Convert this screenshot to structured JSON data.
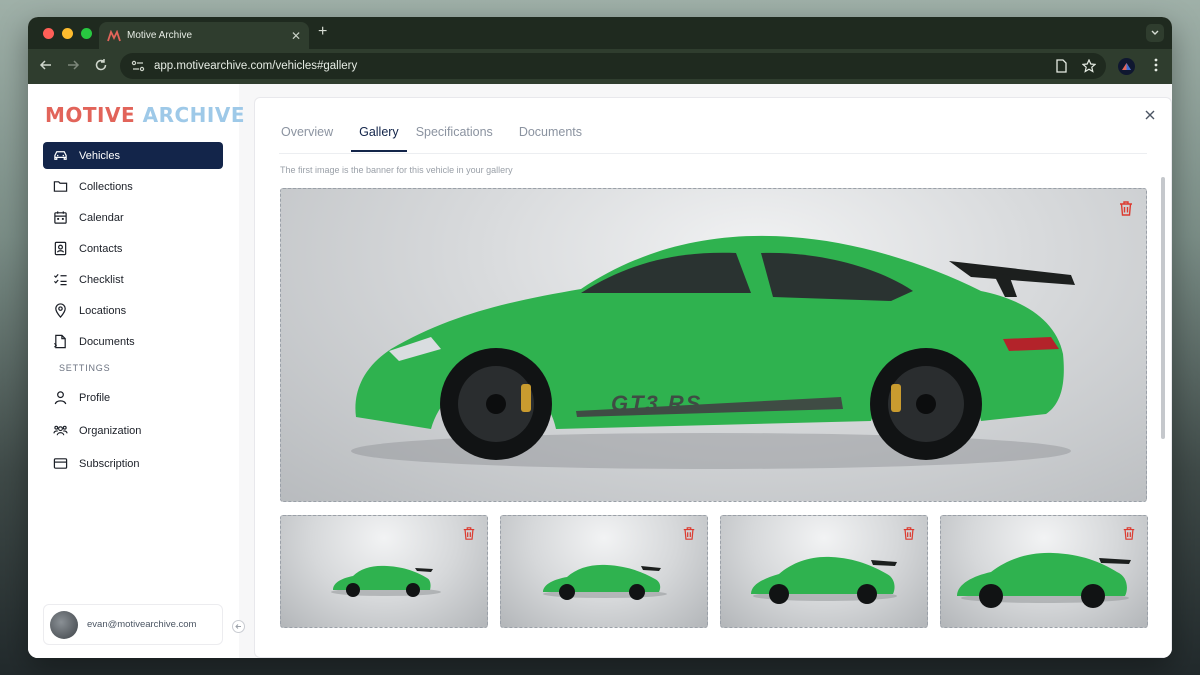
{
  "browser": {
    "tab_title": "Motive Archive",
    "tab_close": "✕",
    "new_tab": "+",
    "url": "app.motivearchive.com/vehicles#gallery"
  },
  "brand": {
    "word1": "MOTIVE",
    "word2": "ARCHIVE",
    "color_red": "#e2645a",
    "color_blue": "#9ec9e8"
  },
  "sidebar": {
    "items": [
      {
        "label": "Vehicles",
        "icon": "car-icon",
        "active": true
      },
      {
        "label": "Collections",
        "icon": "folder-icon",
        "active": false
      },
      {
        "label": "Calendar",
        "icon": "calendar-icon",
        "active": false
      },
      {
        "label": "Contacts",
        "icon": "contact-card-icon",
        "active": false
      },
      {
        "label": "Checklist",
        "icon": "checklist-icon",
        "active": false
      },
      {
        "label": "Locations",
        "icon": "map-pin-icon",
        "active": false
      },
      {
        "label": "Documents",
        "icon": "document-icon",
        "active": false
      }
    ],
    "settings_header": "SETTINGS",
    "settings_items": [
      {
        "label": "Profile",
        "icon": "user-icon"
      },
      {
        "label": "Organization",
        "icon": "users-icon"
      },
      {
        "label": "Subscription",
        "icon": "credit-card-icon"
      }
    ],
    "user_email": "evan@motivearchive.com",
    "active_color": "#13254a"
  },
  "panel": {
    "tabs": [
      {
        "label": "Overview",
        "active": false
      },
      {
        "label": "Gallery",
        "active": true
      },
      {
        "label": "Specifications",
        "active": false
      },
      {
        "label": "Documents",
        "active": false
      }
    ],
    "hint": "The first image is the banner for this vehicle in your gallery",
    "car_color": "#2fb24f",
    "delete_color": "#dc3b30"
  }
}
